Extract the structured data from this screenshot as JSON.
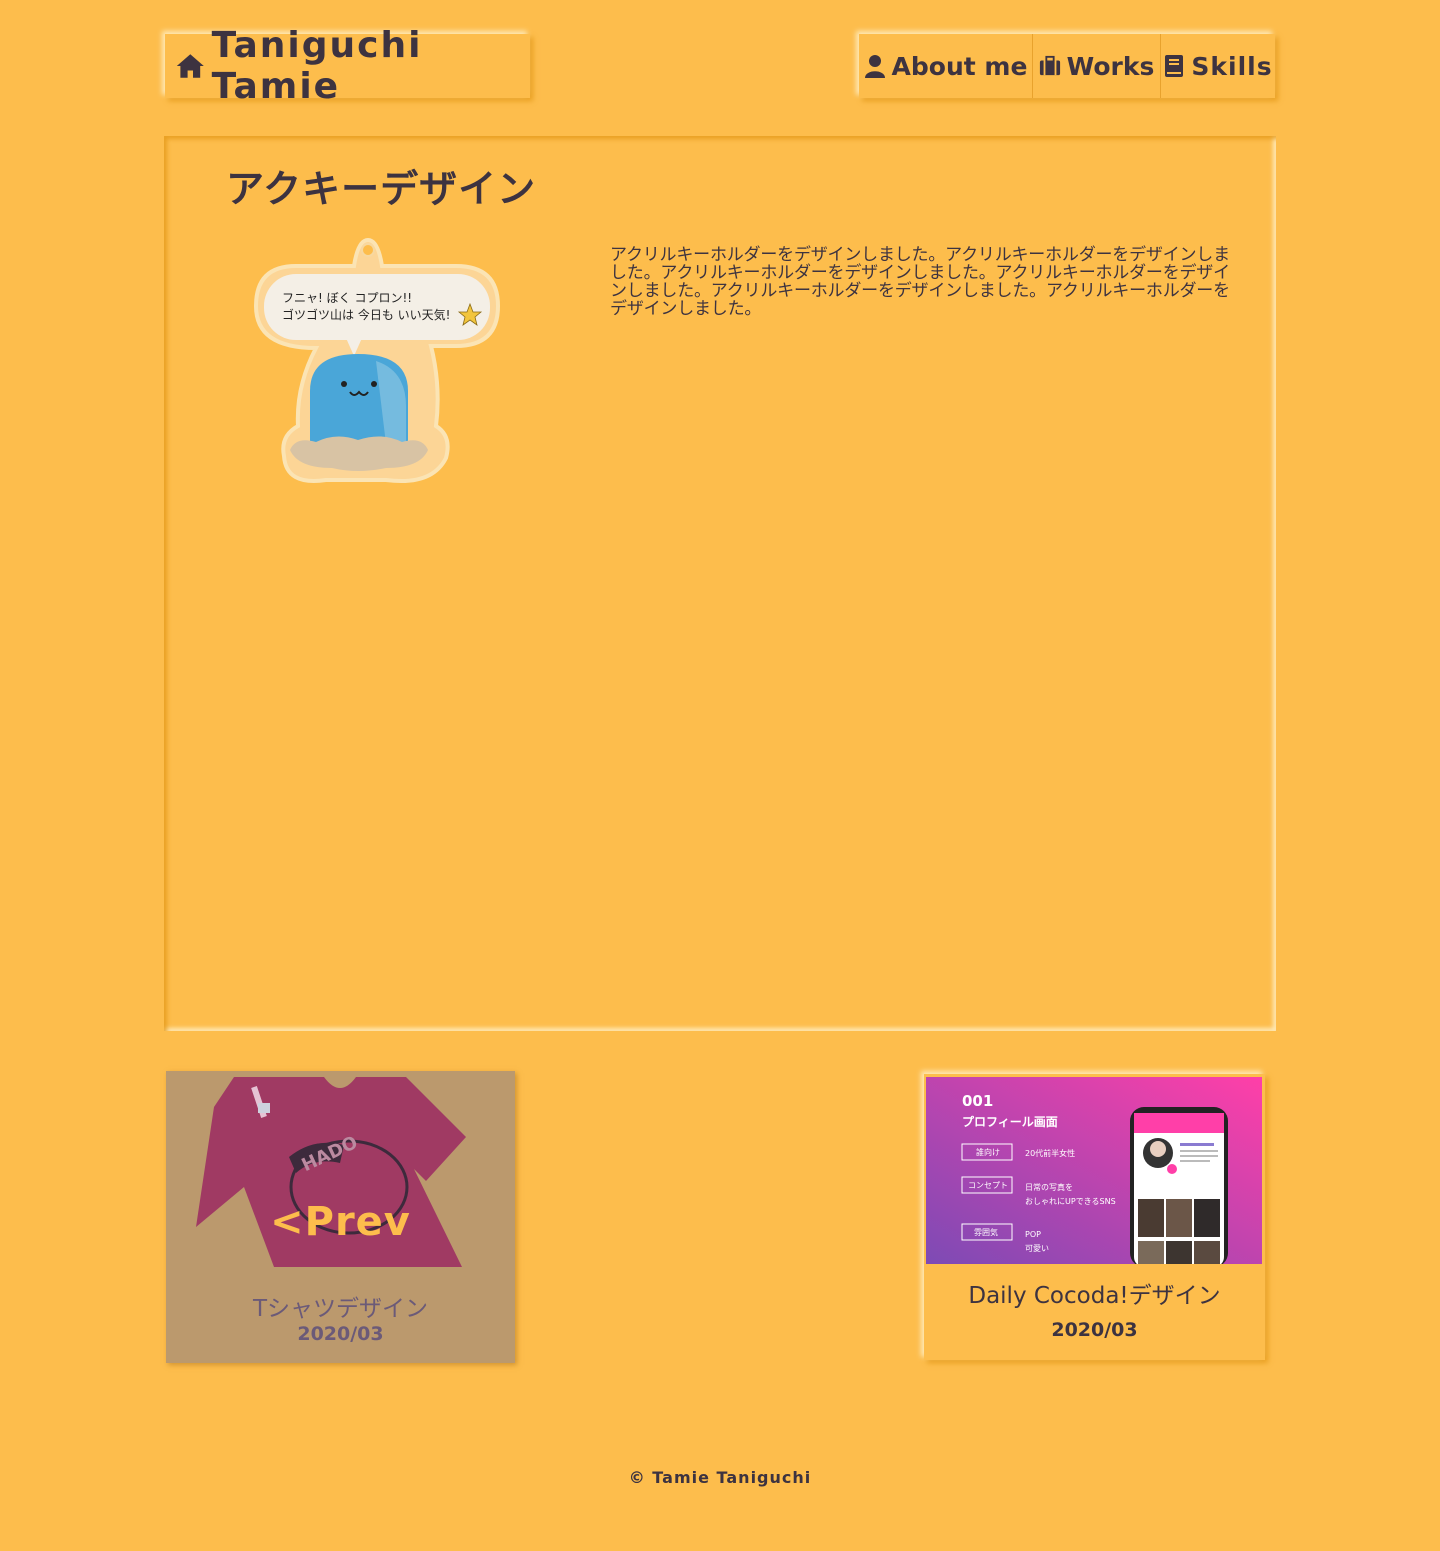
{
  "header": {
    "logo_text": "Taniguchi Tamie",
    "logo_icon": "home-icon",
    "nav": [
      {
        "label": "About me",
        "icon": "user-icon"
      },
      {
        "label": "Works",
        "icon": "briefcase-icon"
      },
      {
        "label": "Skills",
        "icon": "book-icon"
      }
    ]
  },
  "work": {
    "title": "アクキーデザイン",
    "description": "アクリルキーホルダーをデザインしました。アクリルキーホルダーをデザインしました。アクリルキーホルダーをデザインしました。アクリルキーホルダーをデザインしました。アクリルキーホルダーをデザインしました。アクリルキーホルダーをデザインしました。",
    "image_bubble_line1": "フニャ!  ぼく  コプロン!!",
    "image_bubble_line2": "ゴツゴツ山は  今日も  いい天気!"
  },
  "prev": {
    "overlay_label": "<Prev",
    "title": "Tシャツデザイン",
    "date": "2020/03",
    "shirt_print": "HADO"
  },
  "next": {
    "title": "Daily Cocoda!デザイン",
    "date": "2020/03",
    "thumb": {
      "number": "001",
      "heading": "プロフィール画面",
      "rows": [
        {
          "tag": "誰向け",
          "text1": "20代前半女性",
          "text2": ""
        },
        {
          "tag": "コンセプト",
          "text1": "日常の写真を",
          "text2": "おしゃれにUPできるSNS"
        },
        {
          "tag": "雰囲気",
          "text1": "POP",
          "text2": "可愛い"
        }
      ]
    }
  },
  "footer": {
    "text": "© Tamie Taniguchi"
  },
  "colors": {
    "background": "#fdbd4c",
    "text": "#3d3340",
    "accent_pink": "#ff3fa8",
    "accent_purple": "#7d4ab5"
  }
}
